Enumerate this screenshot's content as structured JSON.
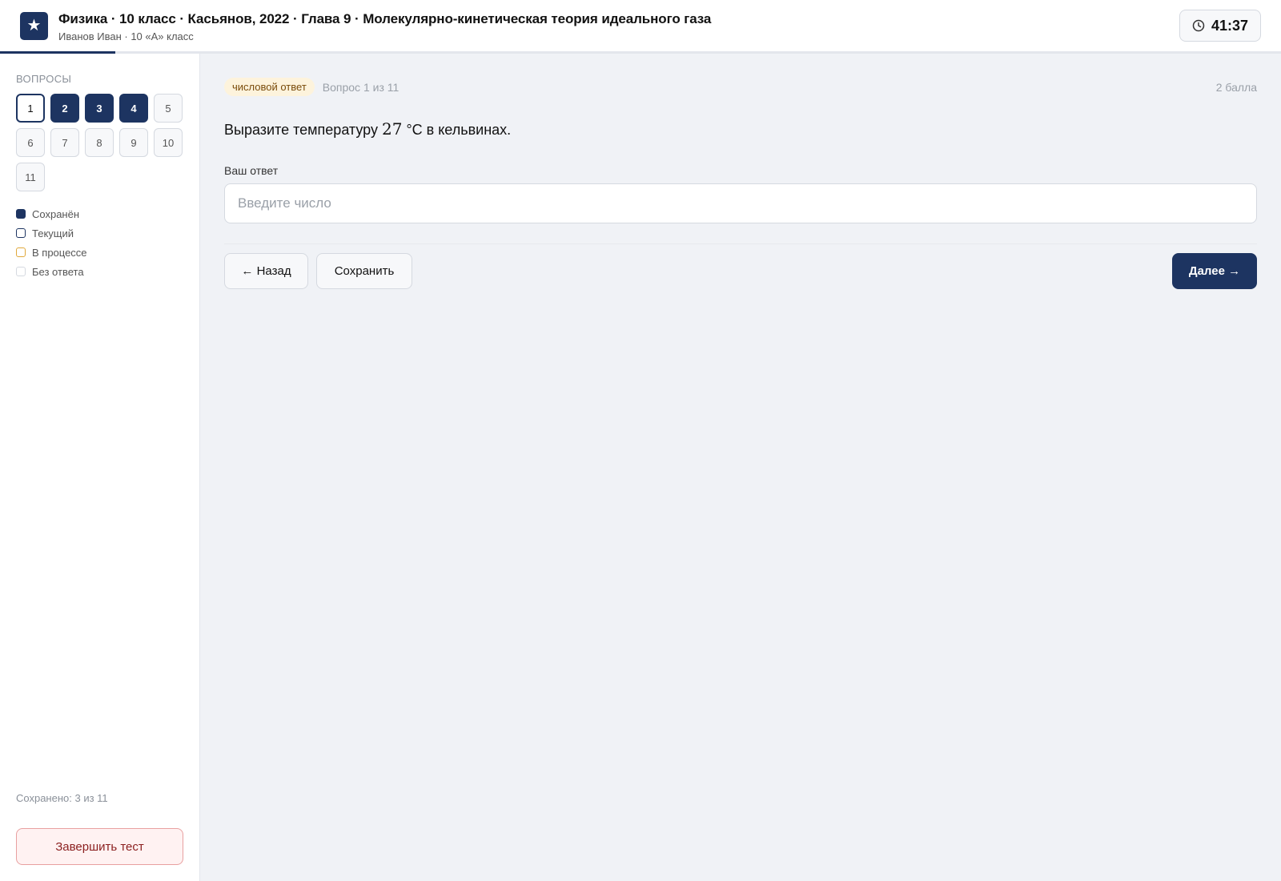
{
  "header": {
    "logo_glyph": "★",
    "title": "Физика · 10 класс · Касьянов, 2022 · Глава 9 · Молекулярно-кинетическая теория идеального газа",
    "subtitle": "Иванов Иван · 10 «А» класс",
    "timer": "41:37",
    "progress_fraction": 0.09
  },
  "sidebar": {
    "heading": "ВОПРОСЫ",
    "questions": [
      {
        "label": "1",
        "state": "current"
      },
      {
        "label": "2",
        "state": "saved"
      },
      {
        "label": "3",
        "state": "saved"
      },
      {
        "label": "4",
        "state": "saved"
      },
      {
        "label": "5",
        "state": "empty"
      },
      {
        "label": "6",
        "state": "empty"
      },
      {
        "label": "7",
        "state": "empty"
      },
      {
        "label": "8",
        "state": "empty"
      },
      {
        "label": "9",
        "state": "empty"
      },
      {
        "label": "10",
        "state": "empty"
      },
      {
        "label": "11",
        "state": "empty"
      }
    ],
    "legend": {
      "saved": "Сохранён",
      "current": "Текущий",
      "in_progress": "В процессе",
      "no_answer": "Без ответа"
    },
    "saved_count": "Сохранено: 3 из 11",
    "finish_label": "Завершить тест"
  },
  "main": {
    "type_badge": "числовой ответ",
    "question_number": "Вопрос 1 из 11",
    "points": "2 балла",
    "question": {
      "before": "Выразите температуру ",
      "math": "27",
      "unit": " °C",
      "after": " в кельвинах."
    },
    "answer_label": "Ваш ответ",
    "answer_placeholder": "Введите число",
    "answer_value": "",
    "back_label": "← Назад",
    "save_label": "Сохранить",
    "next_label": "Далее →"
  },
  "colors": {
    "primary": "#1d3461",
    "badge_bg": "#fdf3dc",
    "in_progress": "#e0a83a",
    "danger": "#8b1f1f"
  }
}
